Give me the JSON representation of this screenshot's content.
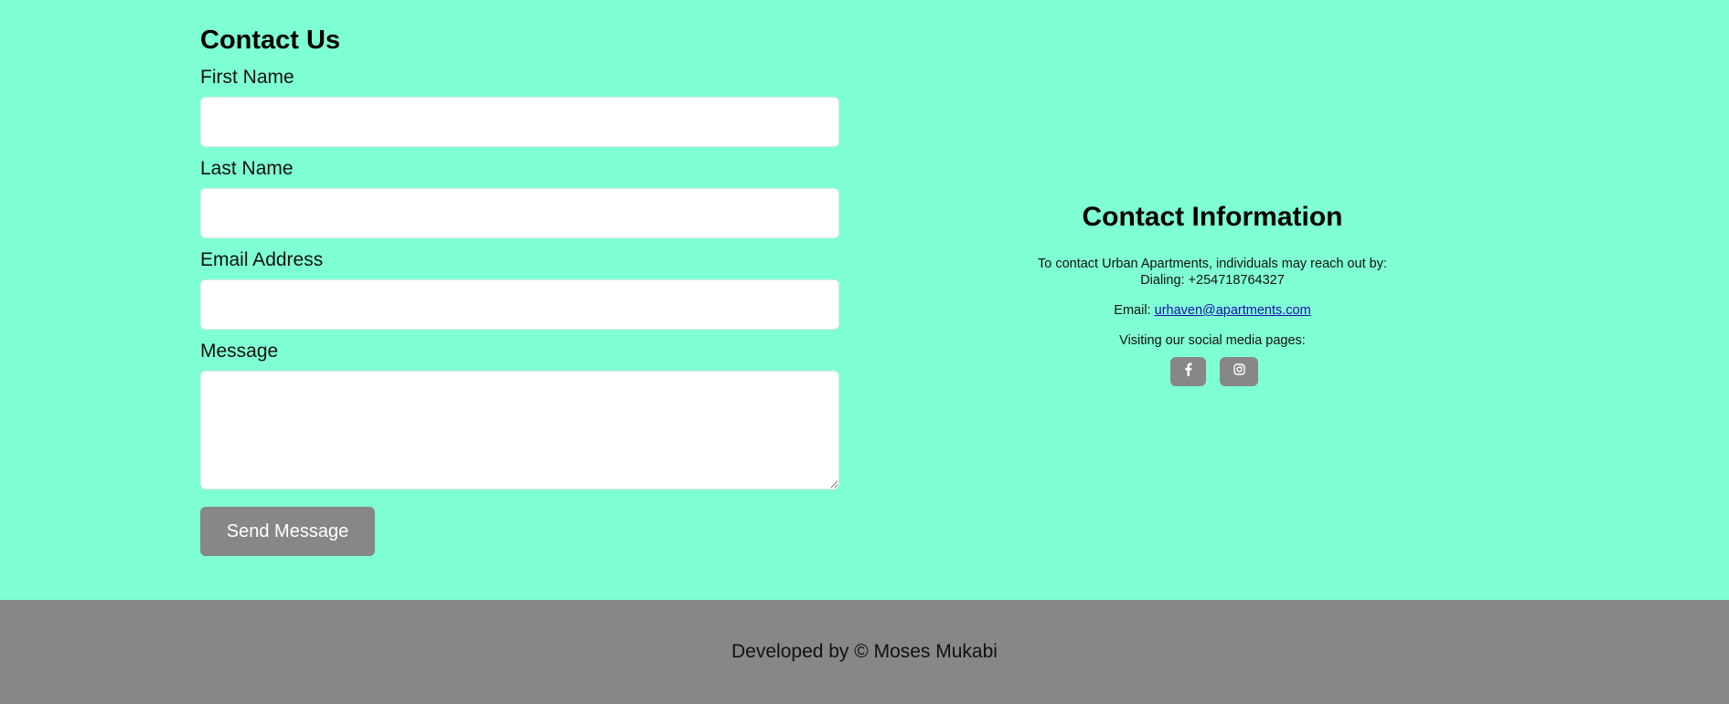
{
  "contact_form": {
    "title": "Contact Us",
    "fields": [
      {
        "label": "First Name",
        "value": "",
        "placeholder": ""
      },
      {
        "label": "Last Name",
        "value": "",
        "placeholder": ""
      },
      {
        "label": "Email Address",
        "value": "",
        "placeholder": ""
      }
    ],
    "message": {
      "label": "Message",
      "value": "",
      "placeholder": ""
    },
    "submit_label": "Send Message"
  },
  "contact_info": {
    "title": "Contact Information",
    "intro_line1": "To contact Urban Apartments, individuals may reach out by:",
    "intro_line2": "Dialing: +254718764327",
    "email_prefix": "Email: ",
    "email": "urhaven@apartments.com",
    "social_text": "Visiting our social media pages:",
    "social_icons": [
      "facebook-icon",
      "instagram-icon"
    ]
  },
  "footer": {
    "text": "Developed by © Moses Mukabi"
  },
  "colors": {
    "background": "#7fffd4",
    "button": "#878787",
    "footer": "#878787",
    "link": "#1a0dab"
  }
}
